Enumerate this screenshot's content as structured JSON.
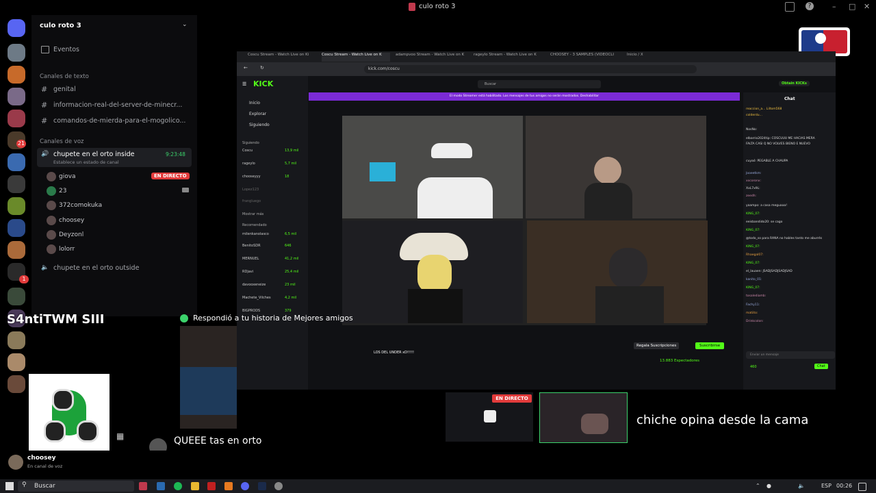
{
  "window": {
    "title": "culo roto 3"
  },
  "server": {
    "name": "culo roto 3",
    "events_label": "Eventos",
    "text_category": "Canales de texto",
    "text_channels": [
      "genital",
      "informacion-real-del-server-de-minecr...",
      "comandos-de-mierda-para-el-mogolico..."
    ],
    "voice_category": "Canales de voz",
    "active_voice": {
      "name": "chupete en el orto inside",
      "timer": "9:23:48",
      "status_placeholder": "Establece un estado de canal"
    },
    "voice_users": [
      {
        "name": "giova",
        "live": "EN DIRECTO"
      },
      {
        "name": "23"
      },
      {
        "name": "372comokuka"
      },
      {
        "name": "choosey"
      },
      {
        "name": "Deyzonl"
      },
      {
        "name": "lolorr"
      }
    ],
    "other_voice": "chupete en el orto outside"
  },
  "rail_badges": [
    "21",
    "1"
  ],
  "stream": {
    "tabs": [
      "Coscu Stream - Watch Live on Ki",
      "Coscu Stream - Watch Live on K",
      "adampvoo Stream - Watch Live on Ki",
      "rageylo Stream - Watch Live on K",
      "CHOOSEY - 3 SAMPLES (VIDEOCLI",
      "Inicio / X"
    ],
    "url": "kick.com/coscu",
    "search_placeholder": "Buscar",
    "kick_logo": "KICK",
    "get_kicks": "Obtain KICKs",
    "nav": [
      "Inicio",
      "Explorar",
      "Siguiendo"
    ],
    "following_label": "Siguiendo",
    "following": [
      {
        "name": "Coscu",
        "viewers": "13,9 mil"
      },
      {
        "name": "rageylo",
        "viewers": "5,7 mil"
      },
      {
        "name": "chooseyyy",
        "viewers": "18"
      },
      {
        "name": "Lopez123",
        "viewers": ""
      },
      {
        "name": "frangluego",
        "viewers": ""
      }
    ],
    "show_more": "Mostrar más",
    "recommended_label": "Recomendado",
    "recommended": [
      {
        "name": "milenkanolasco",
        "viewers": "6,5 mil"
      },
      {
        "name": "BenitoSDR",
        "viewers": "646"
      },
      {
        "name": "MERNUEL",
        "viewers": "41,2 mil"
      },
      {
        "name": "RDjavi",
        "viewers": "25,4 mil"
      },
      {
        "name": "davooxeneize",
        "viewers": "23 mil"
      },
      {
        "name": "Machete_Vilches",
        "viewers": "4,2 mil"
      },
      {
        "name": "BIGPRODS",
        "viewers": "379"
      }
    ],
    "banner": "El modo Streamer está habilitado. Los mensajes de tus amigos no serán mostrados. Deshabilitar",
    "stream_title": "LOS DEL UNDER xD!!!!!",
    "gift_button": "Regala Suscripciones",
    "subscribe_button": "Suscribirse",
    "viewers": "13.883 Espectadores",
    "chat_title": "Chat",
    "chat_messages": [
      "reaccion_a...   Liltom568",
      "colderdu...",
      "NosNo:",
      "elbarrio2024tip: COSCUUU ME HACIAS MERA",
      "FALTA CASI Q NO VOLVES BIENO E NUEVO",
      "cuyaó: PEGABLE A CHAUPA",
      "Jooeetkm:",
      "xxcoronx:",
      "XxL7x9L:",
      "zeedh:",
      "yaampo: a casa meguaaa!",
      "KING_07:",
      "eeisbandido20: se cago",
      "KING_07:",
      "@todo_so para RANA no hables tanto me aburrés",
      "KING_07:",
      "Rhaegal07:",
      "KING_07:",
      "el_lauaen: JSADJSADJSADJSAD",
      "kanito_01:",
      "KING_07:",
      "tosalediamb:",
      "Fachy11:",
      "matiito:",
      "Drinkcolon:"
    ],
    "chat_input_placeholder": "Enviar un mensaje",
    "chat_count": "460",
    "chat_button": "Chat"
  },
  "story_reply": {
    "header": "Respondió a tu historia de Mejores amigos",
    "message": "QUEEE tas en orto"
  },
  "overlay": {
    "tag": "S4ntiTWM  SIII",
    "caption": "chiche opina desde la cama",
    "live_badge": "EN DIRECTO"
  },
  "user_panel": {
    "name": "choosey",
    "status": "En canal de voz"
  },
  "taskbar": {
    "search": "Buscar",
    "lang": "ESP",
    "time": "00:26"
  },
  "colors": {
    "kick_green": "#53fc18",
    "discord_red": "#e23b3b",
    "kick_purple": "#7b2bd6"
  }
}
